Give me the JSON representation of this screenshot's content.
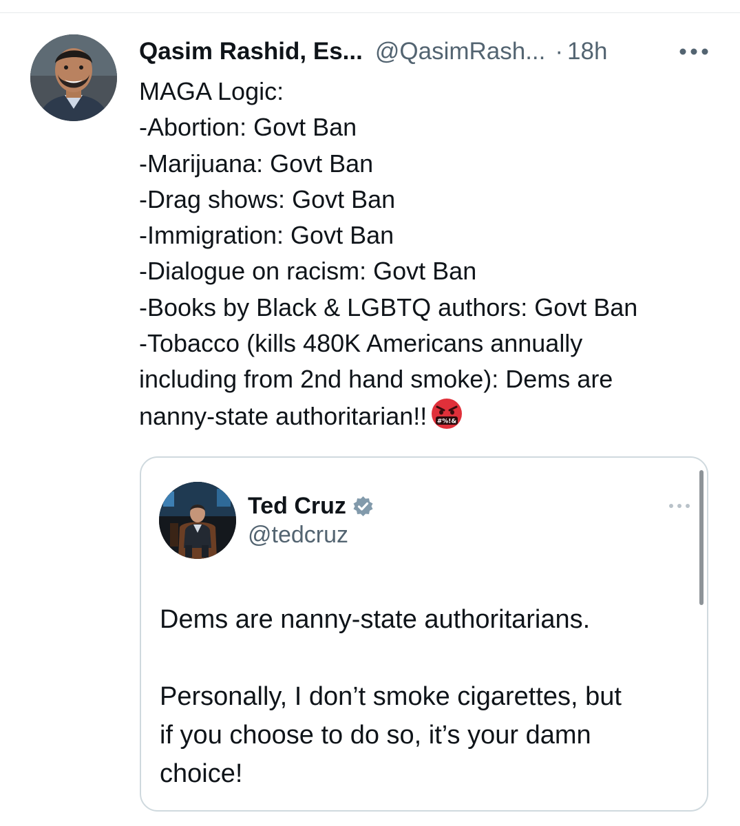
{
  "tweet": {
    "author_name": "Qasim Rashid, Es...",
    "author_handle": "@QasimRash...",
    "separator": "·",
    "timestamp": "18h",
    "lines": [
      "MAGA Logic:",
      "-Abortion: Govt Ban",
      "-Marijuana: Govt Ban",
      "-Drag shows: Govt Ban",
      "-Immigration: Govt Ban",
      "-Dialogue on racism: Govt Ban",
      "-Books by Black & LGBTQ authors: Govt Ban",
      "-Tobacco (kills 480K Americans annually",
      "including from 2nd hand smoke): Dems are",
      "nanny-state authoritarian!!"
    ],
    "emoji_icon": "face-with-symbols-on-mouth-icon",
    "emoji_text": "#%!&"
  },
  "quote": {
    "author_name": "Ted Cruz",
    "verified_icon": "verified-badge-icon",
    "author_handle": "@tedcruz",
    "paragraph1": [
      "Dems are nanny-state authoritarians."
    ],
    "paragraph2": [
      "Personally, I don’t smoke cigarettes, but",
      "if you choose to do so, it’s your damn",
      "choice!"
    ]
  },
  "colors": {
    "text_primary": "#0f1419",
    "text_secondary": "#536471",
    "border": "#cfd9de",
    "verified_badge": "#829aab",
    "emoji_red": "#e0303a"
  }
}
